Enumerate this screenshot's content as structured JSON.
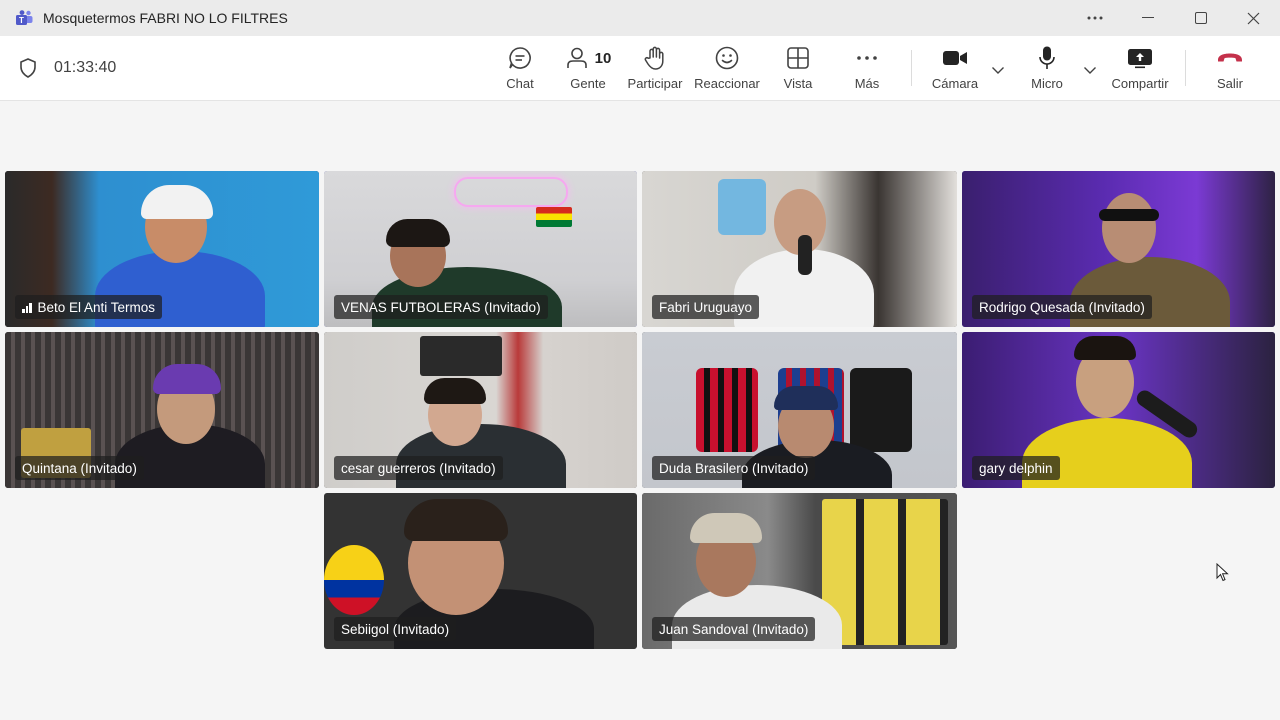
{
  "window": {
    "title": "Mosquetermos FABRI NO LO FILTRES",
    "controls": [
      "more-options",
      "minimize",
      "maximize",
      "close"
    ]
  },
  "meeting": {
    "timer": "01:33:40",
    "toolbar": {
      "chat": "Chat",
      "people": "Gente",
      "people_count": "10",
      "raise_hand": "Participar",
      "react": "Reaccionar",
      "view": "Vista",
      "more": "Más",
      "camera": "Cámara",
      "mic": "Micro",
      "share": "Compartir",
      "leave": "Salir"
    },
    "accent_color": "#7b83eb",
    "leave_color": "#c4314b"
  },
  "participants": [
    {
      "name": "Beto El Anti Termos",
      "speaking": false,
      "signal": true
    },
    {
      "name": "VENAS FUTBOLERAS (Invitado)",
      "speaking": true,
      "signal": false
    },
    {
      "name": "Fabri Uruguayo",
      "speaking": false,
      "signal": false
    },
    {
      "name": "Rodrigo Quesada (Invitado)",
      "speaking": true,
      "signal": false
    },
    {
      "name": "Quintana (Invitado)",
      "speaking": false,
      "signal": false
    },
    {
      "name": "cesar guerreros (Invitado)",
      "speaking": false,
      "signal": false
    },
    {
      "name": "Duda Brasilero (Invitado)",
      "speaking": false,
      "signal": false
    },
    {
      "name": "gary delphin",
      "speaking": true,
      "signal": false
    },
    {
      "name": "Sebiigol (Invitado)",
      "speaking": false,
      "signal": false
    },
    {
      "name": "Juan Sandoval (Invitado)",
      "speaking": false,
      "signal": false
    }
  ]
}
